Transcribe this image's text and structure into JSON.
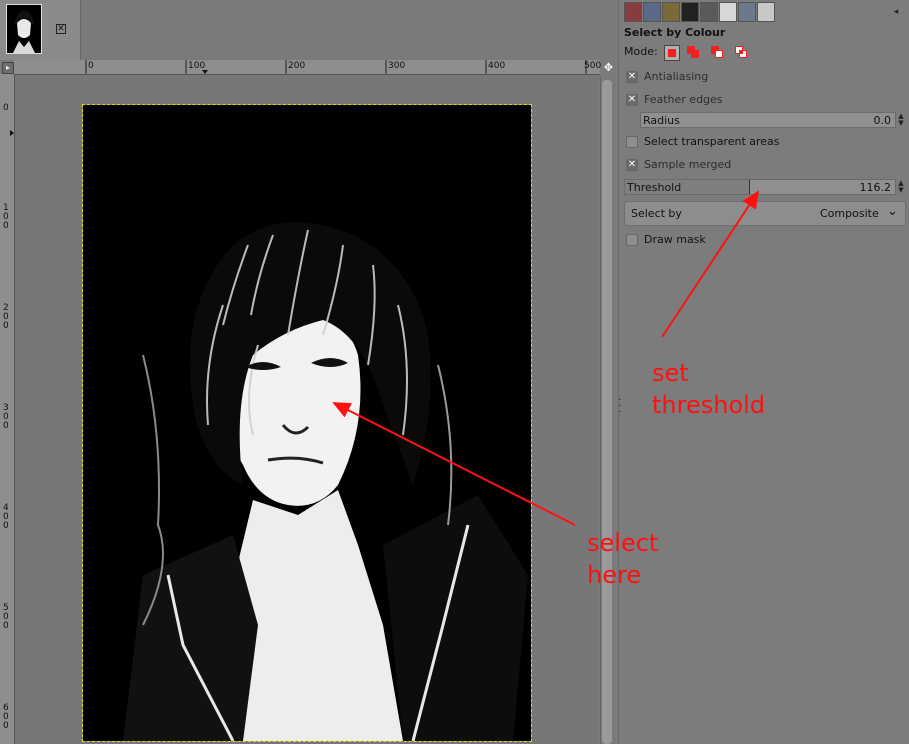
{
  "image_tab": {
    "close_glyph": "✕"
  },
  "rulers": {
    "top_ticks": [
      "0",
      "100",
      "200",
      "300",
      "400",
      "500"
    ],
    "left_ticks": [
      "0",
      "1\n0\n0",
      "2\n0\n0",
      "3\n0\n0",
      "4\n0\n0",
      "5\n0\n0",
      "6\n0\n0"
    ]
  },
  "tool_options": {
    "title": "Select by Colour",
    "mode_label": "Mode:",
    "antialiasing": {
      "label": "Antialiasing",
      "checked": true
    },
    "feather_edges": {
      "label": "Feather edges",
      "checked": true
    },
    "radius": {
      "label": "Radius",
      "value": "0.0"
    },
    "select_transparent": {
      "label": "Select transparent areas",
      "checked": false
    },
    "sample_merged": {
      "label": "Sample merged",
      "checked": true
    },
    "threshold": {
      "label": "Threshold",
      "value": "116.2",
      "fill_fraction": 0.456
    },
    "select_by": {
      "label": "Select by",
      "value": "Composite"
    },
    "draw_mask": {
      "label": "Draw mask",
      "checked": false
    }
  },
  "annotations": {
    "threshold_note": "set\nthreshold",
    "select_note": "select\nhere"
  },
  "colors": {
    "annotation": "#ff1010",
    "selection_marching_ants": "#e7d700"
  }
}
